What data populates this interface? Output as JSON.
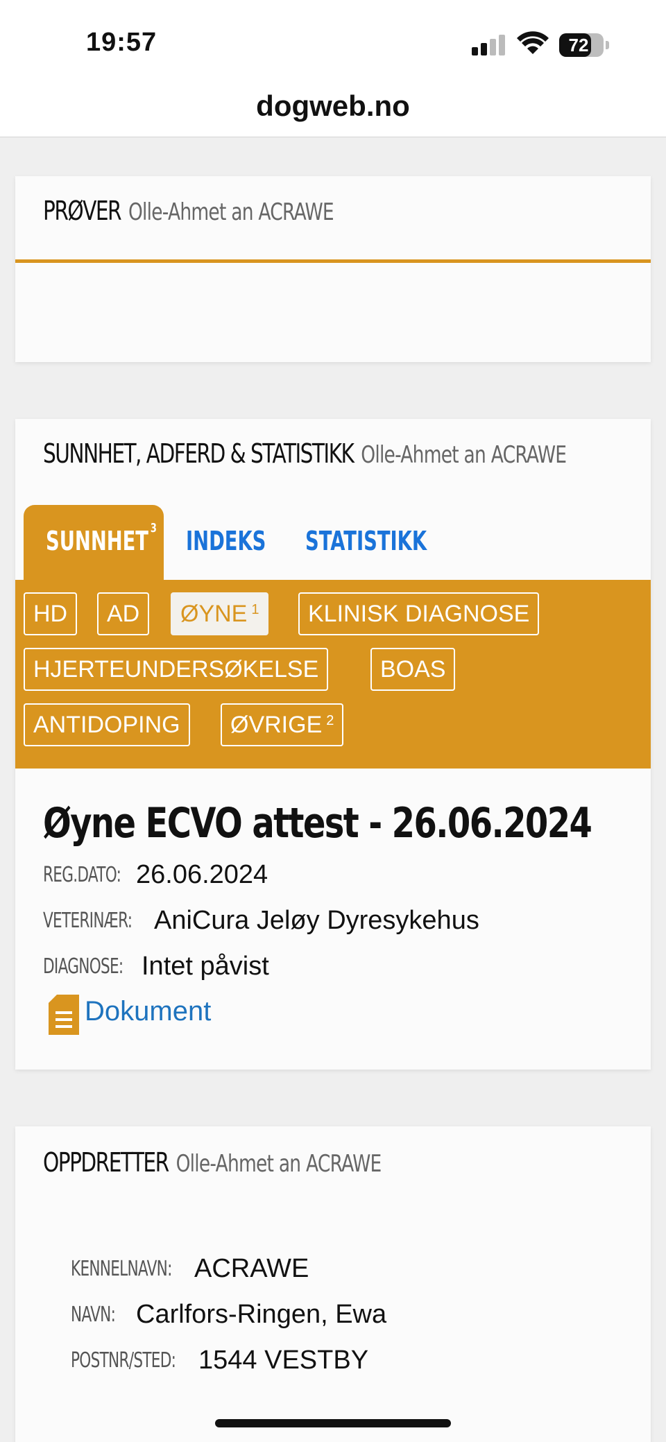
{
  "status": {
    "time": "19:57",
    "battery": "72"
  },
  "browser": {
    "url": "dogweb.no"
  },
  "prover": {
    "title": "PRØVER",
    "dog": "Olle-Ahmet an ACRAWE"
  },
  "health": {
    "title": "SUNNHET, ADFERD & STATISTIKK",
    "dog": "Olle-Ahmet an ACRAWE",
    "tabs": [
      {
        "label": "SUNNHET",
        "count": "3"
      },
      {
        "label": "INDEKS"
      },
      {
        "label": "STATISTIKK"
      }
    ],
    "subtabs": [
      {
        "label": "HD"
      },
      {
        "label": "AD"
      },
      {
        "label": "ØYNE",
        "count": "1"
      },
      {
        "label": "KLINISK DIAGNOSE"
      },
      {
        "label": "HJERTEUNDERSØKELSE"
      },
      {
        "label": "BOAS"
      },
      {
        "label": "ANTIDOPING"
      },
      {
        "label": "ØVRIGE",
        "count": "2"
      }
    ],
    "record": {
      "title": "Øyne ECVO attest - 26.06.2024",
      "reg_label": "REG.DATO:",
      "reg_value": "26.06.2024",
      "vet_label": "VETERINÆR:",
      "vet_value": "AniCura Jeløy Dyresykehus",
      "diag_label": "DIAGNOSE:",
      "diag_value": "Intet påvist",
      "doc_link": "Dokument"
    }
  },
  "breeder": {
    "title": "OPPDRETTER",
    "dog": "Olle-Ahmet an ACRAWE",
    "kennel_label": "KENNELNAVN:",
    "kennel_value": "ACRAWE",
    "name_label": "NAVN:",
    "name_value": "Carlfors-Ringen, Ewa",
    "post_label": "POSTNR/STED:",
    "post_value": "1544 VESTBY"
  },
  "colors": {
    "accent": "#d9951f",
    "link": "#1e73be",
    "tab_blue": "#1a73d9"
  }
}
